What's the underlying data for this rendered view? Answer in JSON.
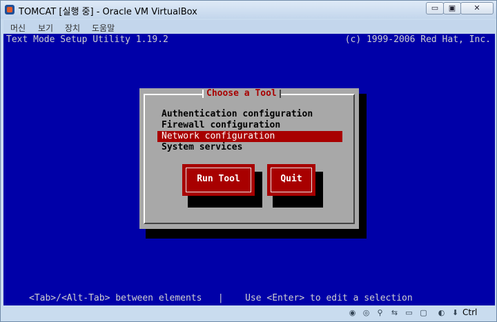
{
  "window": {
    "title": "TOMCAT [실행 중] - Oracle VM VirtualBox",
    "minimize_glyph": "▭",
    "maximize_glyph": "▣",
    "close_glyph": "✕"
  },
  "menu": {
    "items": [
      {
        "label": "머신"
      },
      {
        "label": "보기"
      },
      {
        "label": "장치"
      },
      {
        "label": "도움말"
      }
    ]
  },
  "vm": {
    "header_left": "Text Mode Setup Utility 1.19.2",
    "header_right": "(c) 1999-2006 Red Hat, Inc.",
    "dialog": {
      "title": "Choose a Tool",
      "items": [
        {
          "label": "Authentication configuration"
        },
        {
          "label": "Firewall configuration"
        },
        {
          "label": "Network configuration",
          "selected": true
        },
        {
          "label": "System services"
        }
      ],
      "run_button": "Run Tool",
      "quit_button": "Quit"
    },
    "footer_hint": "<Tab>/<Alt-Tab> between elements   |    Use <Enter> to edit a selection"
  },
  "statusbar": {
    "host_key": "Ctrl",
    "icons": [
      {
        "name": "hard-disk-icon",
        "glyph": "◉"
      },
      {
        "name": "optical-drive-icon",
        "glyph": "◎"
      },
      {
        "name": "usb-icon",
        "glyph": "⚲"
      },
      {
        "name": "network-icon",
        "glyph": "⇆"
      },
      {
        "name": "shared-folders-icon",
        "glyph": "▭"
      },
      {
        "name": "display-icon",
        "glyph": "▢"
      },
      {
        "name": "mouse-integration-icon",
        "glyph": "◐"
      },
      {
        "name": "host-key-arrow-icon",
        "glyph": "⬇"
      }
    ]
  },
  "colors": {
    "screen_bg": "#0000a8",
    "dialog_bg": "#a8a8a8",
    "accent_red": "#a80000"
  }
}
